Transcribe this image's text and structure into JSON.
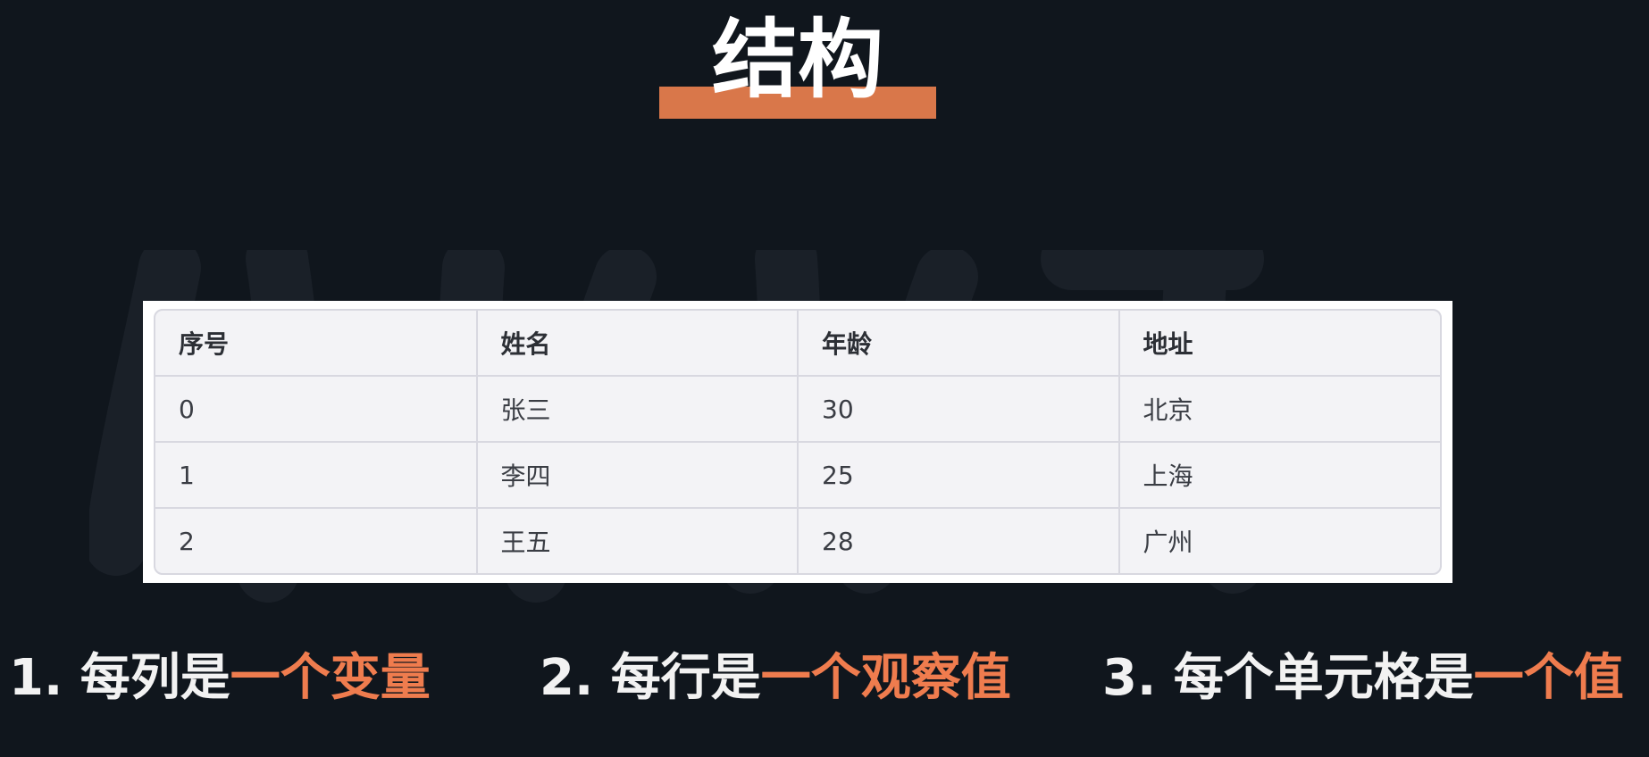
{
  "title": "结构",
  "colors": {
    "background": "#10161d",
    "accent": "#ef7c4e",
    "title_bar": "#d9774a"
  },
  "table": {
    "headers": [
      "序号",
      "姓名",
      "年龄",
      "地址"
    ],
    "rows": [
      [
        "0",
        "张三",
        "30",
        "北京"
      ],
      [
        "1",
        "李四",
        "25",
        "上海"
      ],
      [
        "2",
        "王五",
        "28",
        "广州"
      ]
    ]
  },
  "rules": [
    {
      "prefix": "1. 每列是",
      "highlight": "一个变量"
    },
    {
      "prefix": "2. 每行是",
      "highlight": "一个观察值"
    },
    {
      "prefix": "3. 每个单元格是",
      "highlight": "一个值"
    }
  ]
}
